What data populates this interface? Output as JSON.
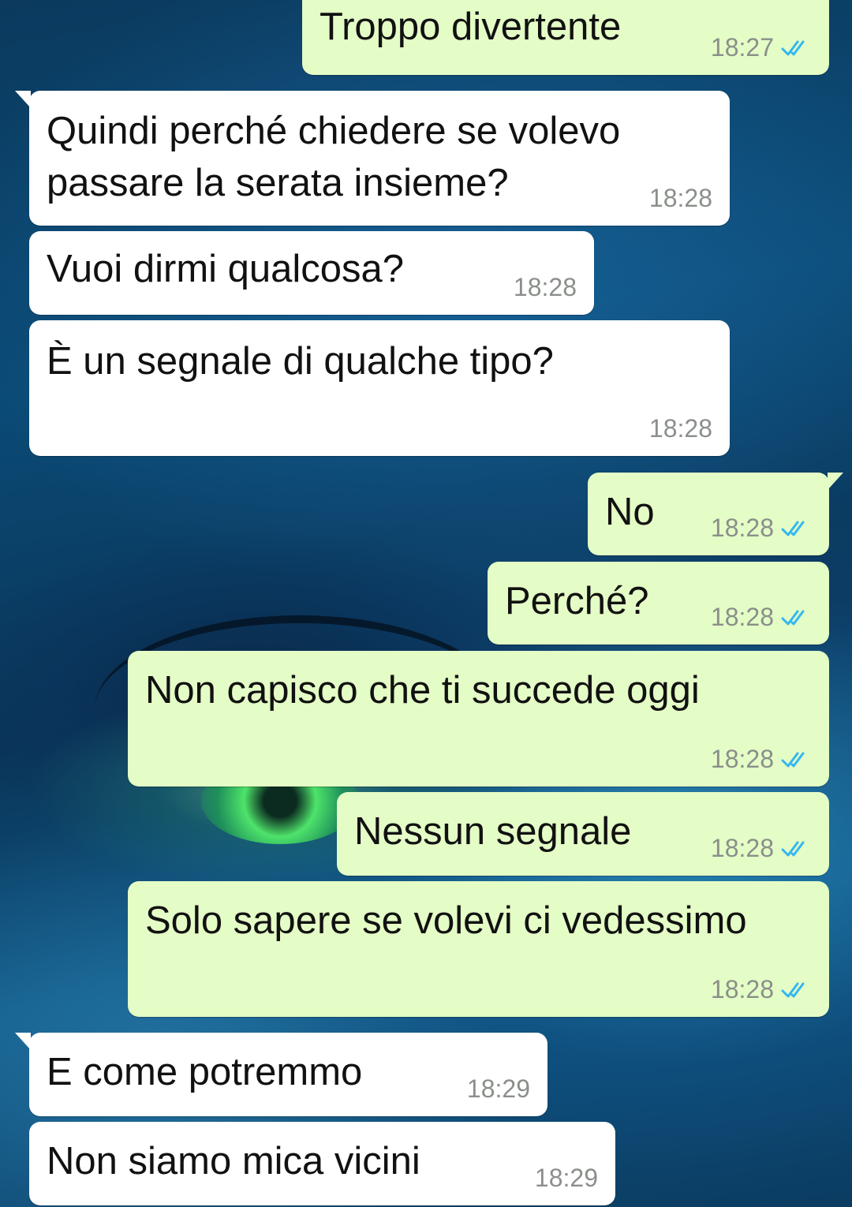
{
  "colors": {
    "incoming_bubble": "#ffffff",
    "outgoing_bubble": "#e4fcc6",
    "timestamp": "#8a8f8a",
    "read_ticks": "#34b7f1"
  },
  "messages": [
    {
      "direction": "out",
      "text": "Troppo divertente",
      "time": "18:27",
      "status": "read-double-tick-icon"
    },
    {
      "direction": "in",
      "text": "Quindi perché chiedere se volevo\npassare la serata insieme?",
      "time": "18:28"
    },
    {
      "direction": "in",
      "text": "Vuoi dirmi qualcosa?",
      "time": "18:28"
    },
    {
      "direction": "in",
      "text": "È un segnale di qualche tipo?",
      "time": "18:28"
    },
    {
      "direction": "out",
      "text": "No",
      "time": "18:28",
      "status": "read-double-tick-icon"
    },
    {
      "direction": "out",
      "text": "Perché?",
      "time": "18:28",
      "status": "read-double-tick-icon"
    },
    {
      "direction": "out",
      "text": "Non capisco che ti succede oggi",
      "time": "18:28",
      "status": "read-double-tick-icon"
    },
    {
      "direction": "out",
      "text": "Nessun segnale",
      "time": "18:28",
      "status": "read-double-tick-icon"
    },
    {
      "direction": "out",
      "text": "Solo sapere se volevi ci vedessimo",
      "time": "18:28",
      "status": "read-double-tick-icon"
    },
    {
      "direction": "in",
      "text": "E come potremmo",
      "time": "18:29"
    },
    {
      "direction": "in",
      "text": "Non siamo mica vicini",
      "time": "18:29"
    }
  ]
}
